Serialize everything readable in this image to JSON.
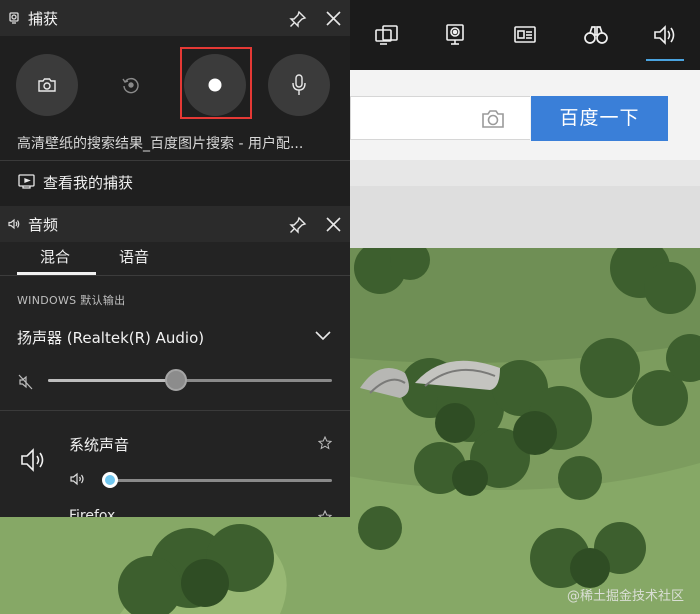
{
  "browser": {
    "search_button": "百度一下",
    "watermark": "@稀土掘金技术社区"
  },
  "topbar": {
    "icons": [
      "widget-icon",
      "capture-icon",
      "performance-icon",
      "looking-for-group-icon",
      "audio-icon"
    ],
    "active_icon": "audio-icon",
    "accent": "#4aa3df"
  },
  "capture": {
    "title": "捕获",
    "buttons": {
      "screenshot": "camera-icon",
      "record_last": "replay-icon",
      "record": "record-dot-icon",
      "mic": "microphone-icon"
    },
    "highlight_color": "#e53935",
    "app_info": "高清壁纸的搜索结果_百度图片搜索 - 用户配...",
    "show_captures": "查看我的捕获"
  },
  "audio": {
    "title": "音频",
    "tabs": [
      "混合",
      "语音"
    ],
    "active_tab": "混合",
    "output_label": "WINDOWS 默认输出",
    "device": "扬声器 (Realtek(R) Audio)",
    "master_volume": 0.45,
    "apps": [
      {
        "name": "系统声音",
        "volume": 0.0,
        "accent": "#71c7ef"
      },
      {
        "name": "Firefox"
      }
    ]
  }
}
